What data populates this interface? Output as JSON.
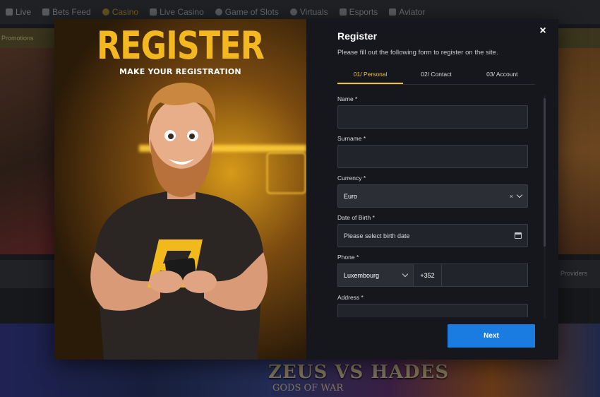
{
  "nav": {
    "items": [
      {
        "label": "Live",
        "icon": "live-icon"
      },
      {
        "label": "Bets Feed",
        "icon": "feed-icon"
      },
      {
        "label": "Casino",
        "icon": "casino-icon",
        "active": true
      },
      {
        "label": "Live Casino",
        "icon": "live-casino-icon"
      },
      {
        "label": "Game of Slots",
        "icon": "slots-icon"
      },
      {
        "label": "Virtuals",
        "icon": "virtuals-icon"
      },
      {
        "label": "Esports",
        "icon": "esports-icon"
      },
      {
        "label": "Aviator",
        "icon": "aviator-icon"
      }
    ]
  },
  "promobar": {
    "label": "Promotions"
  },
  "filters": {
    "providers_label": "Providers"
  },
  "games": {
    "featured_title": "ZEUS VS HADES",
    "featured_subtitle": "GODS OF WAR"
  },
  "modal": {
    "art": {
      "title": "REGISTER",
      "subtitle": "MAKE YOUR REGISTRATION"
    },
    "title": "Register",
    "description": "Please fill out the following form to register on the site.",
    "close_icon": "×",
    "tabs": [
      {
        "label": "01/ Personal",
        "active": true
      },
      {
        "label": "02/ Contact"
      },
      {
        "label": "03/ Account"
      }
    ],
    "fields": {
      "name": {
        "label": "Name *",
        "value": ""
      },
      "surname": {
        "label": "Surname *",
        "value": ""
      },
      "currency": {
        "label": "Currency *",
        "value": "Euro",
        "clear_icon": "×"
      },
      "dob": {
        "label": "Date of Birth *",
        "placeholder": "Please select birth date"
      },
      "phone": {
        "label": "Phone *",
        "country": "Luxembourg",
        "code": "+352",
        "value": ""
      },
      "address": {
        "label": "Address *",
        "value": ""
      }
    },
    "next_label": "Next"
  },
  "colors": {
    "accent": "#f1c23a",
    "primary_button": "#1a7ce0",
    "form_bg": "#16171c"
  }
}
